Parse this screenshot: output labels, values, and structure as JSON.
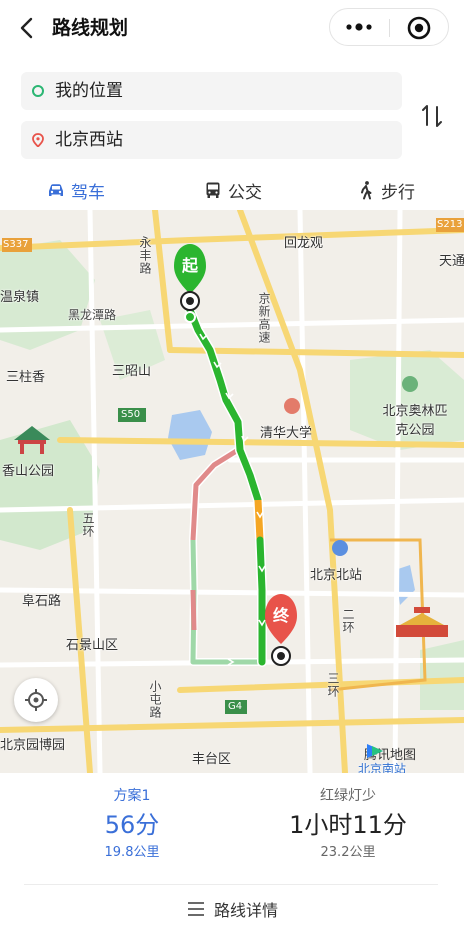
{
  "header": {
    "title": "路线规划",
    "back_icon": "chevron-left-icon",
    "more_icon": "more-dots-icon",
    "close_icon": "target-circle-icon"
  },
  "route": {
    "origin": "我的位置",
    "destination": "北京西站",
    "origin_color": "#2bb673",
    "destination_color": "#e8534a",
    "swap_icon": "swap-vertical-icon"
  },
  "modes": [
    {
      "label": "驾车",
      "icon": "car-icon",
      "active": true
    },
    {
      "label": "公交",
      "icon": "bus-icon",
      "active": false
    },
    {
      "label": "步行",
      "icon": "walk-icon",
      "active": false
    }
  ],
  "map": {
    "start_marker": "起",
    "end_marker": "终",
    "labels": {
      "s337": "S337",
      "s213": "S213",
      "yongfeng": "永丰路",
      "huilongguan": "回龙观",
      "tianjing": "天通",
      "wenquan": "温泉镇",
      "heilongtan": "黑龙潭路",
      "jingxin": "京新高速",
      "sanzhaishan": "三昭山",
      "sanzhuxiang": "三柱香",
      "s50": "S50",
      "olympic": "北京奥林匹克公园",
      "tsinghua": "清华大学",
      "xiangshan": "香山公园",
      "wuhuan": "五环",
      "beijingnorth": "北京北站",
      "fushi": "阜石路",
      "shijingshan": "石景山区",
      "erhuan": "二环",
      "xiaotun": "小屯路",
      "g4": "G4",
      "sanhuan": "三环",
      "fengtai": "丰台区",
      "yuanbo": "北京园博园",
      "beijingsouth": "北京南站"
    },
    "watermark": "腾讯地图",
    "locate_icon": "locate-crosshair-icon"
  },
  "plans": [
    {
      "name": "方案1",
      "time": "56分",
      "distance": "19.8公里",
      "active": true
    },
    {
      "name": "红绿灯少",
      "time": "1小时11分",
      "distance": "23.2公里",
      "active": false
    }
  ],
  "details": {
    "label": "路线详情",
    "icon": "list-lines-icon"
  },
  "colors": {
    "accent": "#3a6fd8",
    "route_green": "#2bb52f",
    "route_orange": "#f5a623",
    "alt_route": "#9fd8a8",
    "alt_route_red": "#e08a8a"
  }
}
